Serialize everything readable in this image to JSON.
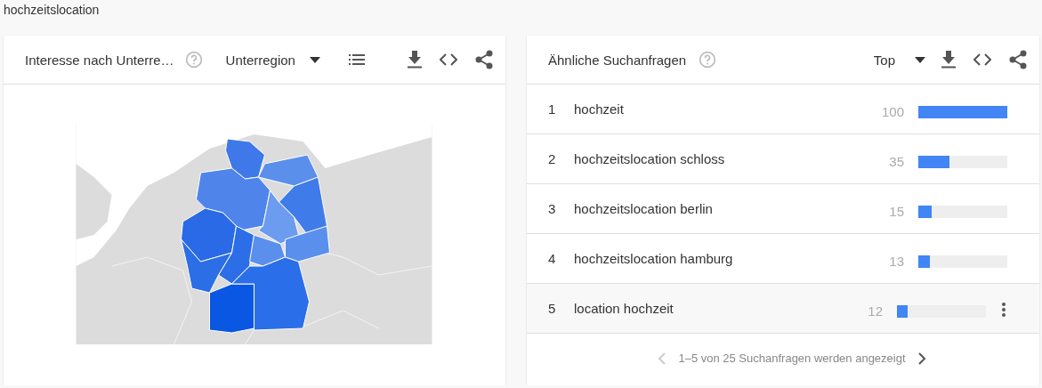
{
  "page_title": "hochzeitslocation",
  "region_card": {
    "title": "Interesse nach Unterre…",
    "dropdown": "Unterregion"
  },
  "queries_card": {
    "title": "Ähnliche Suchanfragen",
    "dropdown": "Top",
    "rows": [
      {
        "rank": "1",
        "query": "hochzeit",
        "value": "100",
        "level": 1,
        "hovered": false
      },
      {
        "rank": "2",
        "query": "hochzeitslocation schloss",
        "value": "35",
        "level": 0.35,
        "hovered": false
      },
      {
        "rank": "3",
        "query": "hochzeitslocation berlin",
        "value": "15",
        "level": 0.15,
        "hovered": false
      },
      {
        "rank": "4",
        "query": "hochzeitslocation hamburg",
        "value": "13",
        "level": 0.13,
        "hovered": false
      },
      {
        "rank": "5",
        "query": "location hochzeit",
        "value": "12",
        "level": 0.12,
        "hovered": true
      }
    ],
    "pagination": {
      "text": "1–5 von 25 Suchanfragen werden angezeigt",
      "prev_disabled": true,
      "next_disabled": false
    }
  }
}
